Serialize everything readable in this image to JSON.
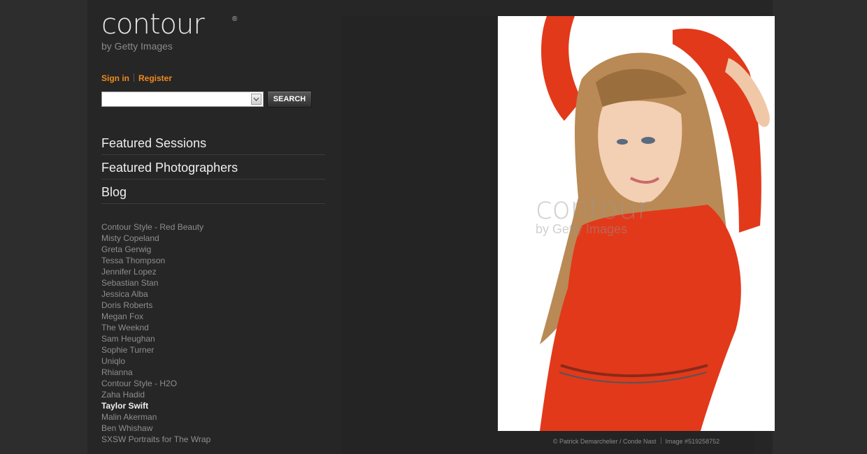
{
  "logo": {
    "wordmark": "contour",
    "registered": "®",
    "subtitle": "by Getty Images"
  },
  "auth": {
    "sign_in": "Sign in",
    "register": "Register"
  },
  "search": {
    "value": "",
    "placeholder": "",
    "button_label": "SEARCH"
  },
  "nav": [
    {
      "label": "Featured Sessions"
    },
    {
      "label": "Featured Photographers"
    },
    {
      "label": "Blog"
    }
  ],
  "sessions": [
    {
      "label": "Contour Style - Red Beauty",
      "active": false
    },
    {
      "label": "Misty Copeland",
      "active": false
    },
    {
      "label": "Greta Gerwig",
      "active": false
    },
    {
      "label": "Tessa Thompson",
      "active": false
    },
    {
      "label": "Jennifer Lopez",
      "active": false
    },
    {
      "label": "Sebastian Stan",
      "active": false
    },
    {
      "label": "Jessica Alba",
      "active": false
    },
    {
      "label": "Doris Roberts",
      "active": false
    },
    {
      "label": "Megan Fox",
      "active": false
    },
    {
      "label": "The Weeknd",
      "active": false
    },
    {
      "label": "Sam Heughan",
      "active": false
    },
    {
      "label": "Sophie Turner",
      "active": false
    },
    {
      "label": "Uniqlo",
      "active": false
    },
    {
      "label": "Rhianna",
      "active": false
    },
    {
      "label": "Contour Style - H2O",
      "active": false
    },
    {
      "label": "Zaha Hadid",
      "active": false
    },
    {
      "label": "Taylor Swift",
      "active": true
    },
    {
      "label": "Malin Akerman",
      "active": false
    },
    {
      "label": "Ben Whishaw",
      "active": false
    },
    {
      "label": "SXSW Portraits for The Wrap",
      "active": false
    }
  ],
  "photo": {
    "watermark_line1": "contour",
    "watermark_line2": "by Getty Images",
    "credit": "© Patrick Demarchelier / Conde Nast",
    "image_number": "Image #519258752"
  },
  "colors": {
    "accent": "#f08a1c",
    "background": "#262626",
    "dress": "#e2391b"
  }
}
